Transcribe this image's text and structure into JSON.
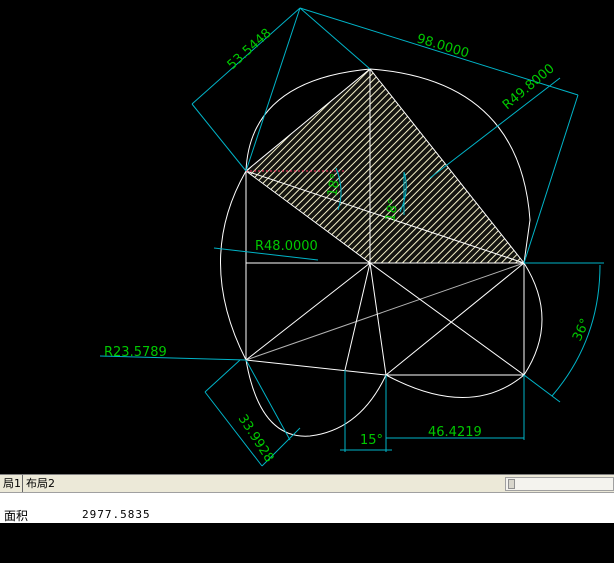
{
  "drawing": {
    "dimensions": {
      "d1": "53.5448",
      "d2": "98.0000",
      "d3": "R49.8000",
      "d4": "R48.0000",
      "d5": "18°",
      "d6": "18°",
      "d7": "36°",
      "d8": "R23.5789",
      "d9": "33.9928",
      "d10": "15°",
      "d11": "46.4219"
    },
    "colors": {
      "background": "#000000",
      "geometry": "#ffffff",
      "dimension_lines": "#00b4c8",
      "dimension_text": "#00c800",
      "hatch_fill": "#fffde0"
    }
  },
  "tabs": {
    "layout1": "局1",
    "layout2": "布局2"
  },
  "command": {
    "label": "面积",
    "value": "2977.5835"
  }
}
